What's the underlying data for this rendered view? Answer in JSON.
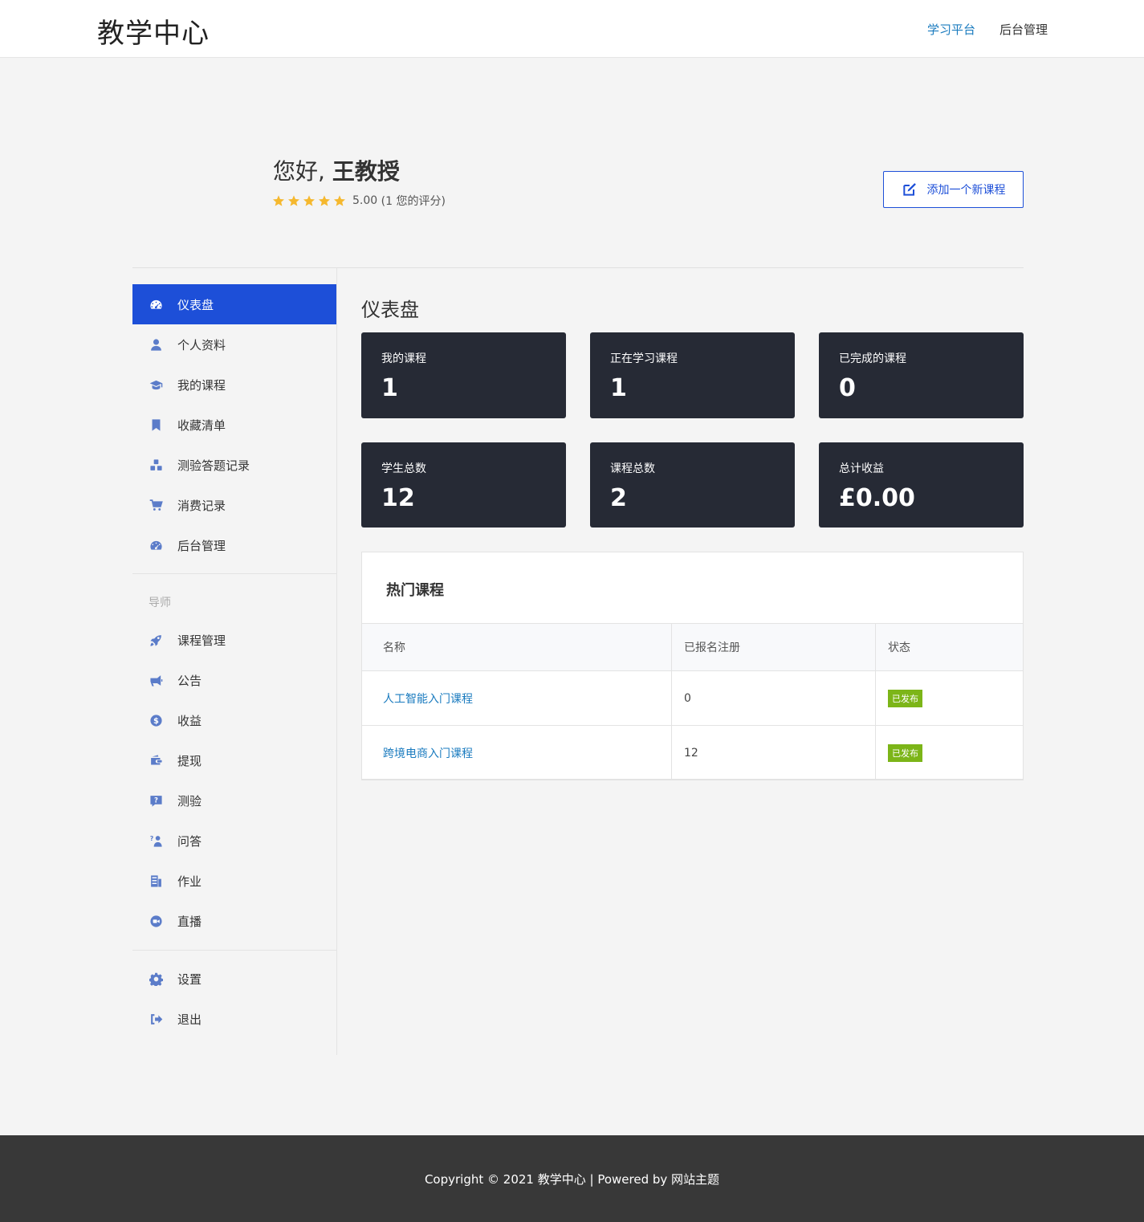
{
  "header": {
    "logo": "教学中心",
    "nav": [
      "学习平台",
      "后台管理"
    ]
  },
  "profile": {
    "greeting": "您好,",
    "name": "王教授",
    "rating_value": "5.00",
    "rating_text": "(1 您的评分)",
    "stars": 5,
    "add_course_label": "添加一个新课程"
  },
  "sidebar": {
    "items": [
      {
        "label": "仪表盘",
        "icon": "dashboard-icon"
      },
      {
        "label": "个人资料",
        "icon": "user-icon"
      },
      {
        "label": "我的课程",
        "icon": "graduation-cap-icon"
      },
      {
        "label": "收藏清单",
        "icon": "bookmark-icon"
      },
      {
        "label": "测验答题记录",
        "icon": "cubes-icon"
      },
      {
        "label": "消费记录",
        "icon": "cart-icon"
      },
      {
        "label": "后台管理",
        "icon": "dashboard-icon"
      }
    ],
    "instructor_section": "导师",
    "instructor_items": [
      {
        "label": "课程管理",
        "icon": "rocket-icon"
      },
      {
        "label": "公告",
        "icon": "megaphone-icon"
      },
      {
        "label": "收益",
        "icon": "dollar-icon"
      },
      {
        "label": "提现",
        "icon": "wallet-icon"
      },
      {
        "label": "测验",
        "icon": "question-icon"
      },
      {
        "label": "问答",
        "icon": "qa-icon"
      },
      {
        "label": "作业",
        "icon": "assignment-icon"
      },
      {
        "label": "直播",
        "icon": "video-icon"
      }
    ],
    "bottom_items": [
      {
        "label": "设置",
        "icon": "gear-icon"
      },
      {
        "label": "退出",
        "icon": "logout-icon"
      }
    ]
  },
  "main": {
    "title": "仪表盘",
    "stats": [
      {
        "label": "我的课程",
        "value": "1"
      },
      {
        "label": "正在学习课程",
        "value": "1"
      },
      {
        "label": "已完成的课程",
        "value": "0"
      },
      {
        "label": "学生总数",
        "value": "12"
      },
      {
        "label": "课程总数",
        "value": "2"
      },
      {
        "label": "总计收益",
        "value": "£0.00"
      }
    ],
    "popular": {
      "title": "热门课程",
      "columns": [
        "名称",
        "已报名注册",
        "状态"
      ],
      "rows": [
        {
          "name": "人工智能入门课程",
          "enrolled": "0",
          "status": "已发布"
        },
        {
          "name": "跨境电商入门课程",
          "enrolled": "12",
          "status": "已发布"
        }
      ]
    }
  },
  "footer": {
    "text": "Copyright © 2021 教学中心 | Powered by 网站主题"
  },
  "colors": {
    "accent": "#1d4fd8",
    "card_bg": "#262a35",
    "link": "#1a7bbf",
    "badge": "#7cb518",
    "star": "#f5b82e"
  }
}
